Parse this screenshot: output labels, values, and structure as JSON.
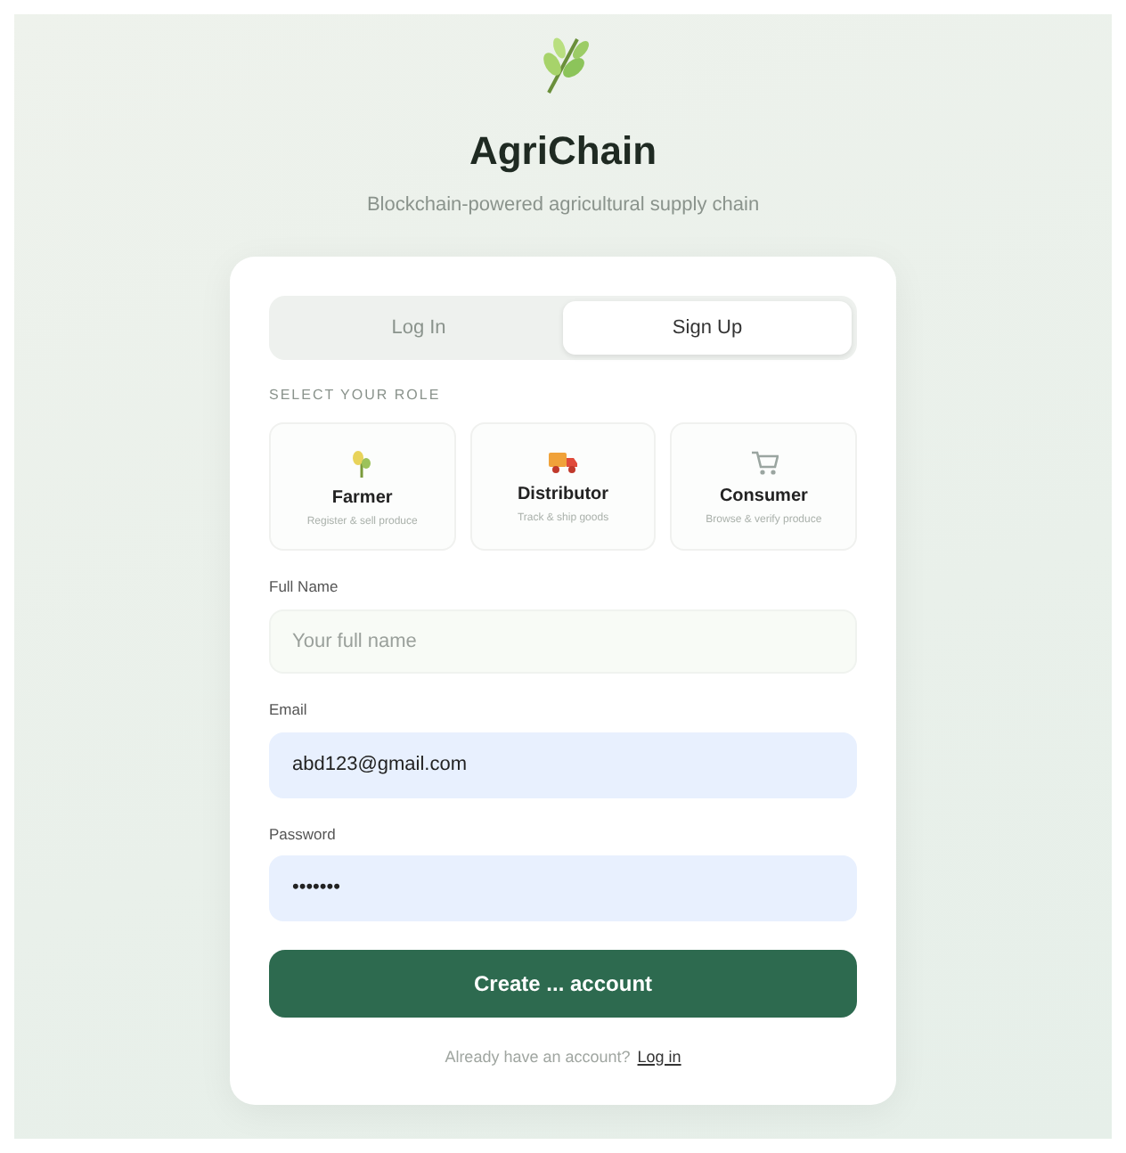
{
  "brand": {
    "title": "AgriChain",
    "tagline": "Blockchain-powered agricultural supply chain"
  },
  "tabs": [
    {
      "label": "Log In",
      "selected": false
    },
    {
      "label": "Sign Up",
      "selected": true
    }
  ],
  "role_heading": "SELECT YOUR ROLE",
  "roles": [
    {
      "kind": "farmer",
      "name": "Farmer",
      "description": "Register & sell produce",
      "selected": false
    },
    {
      "kind": "distributor",
      "name": "Distributor",
      "description": "Track & ship goods",
      "selected": false
    },
    {
      "kind": "consumer",
      "name": "Consumer",
      "description": "Browse & verify produce",
      "selected": false
    }
  ],
  "fields": [
    {
      "label": "Full Name",
      "placeholder": "Your full name",
      "autofilled": false
    },
    {
      "label": "Email",
      "value": "abd123@gmail.com",
      "autofilled": true
    },
    {
      "label": "Password",
      "value": "•••••••",
      "autofilled": true
    }
  ],
  "submit": "Create ... account",
  "footer": {
    "text": "Already have an account?",
    "link": "Log in"
  }
}
